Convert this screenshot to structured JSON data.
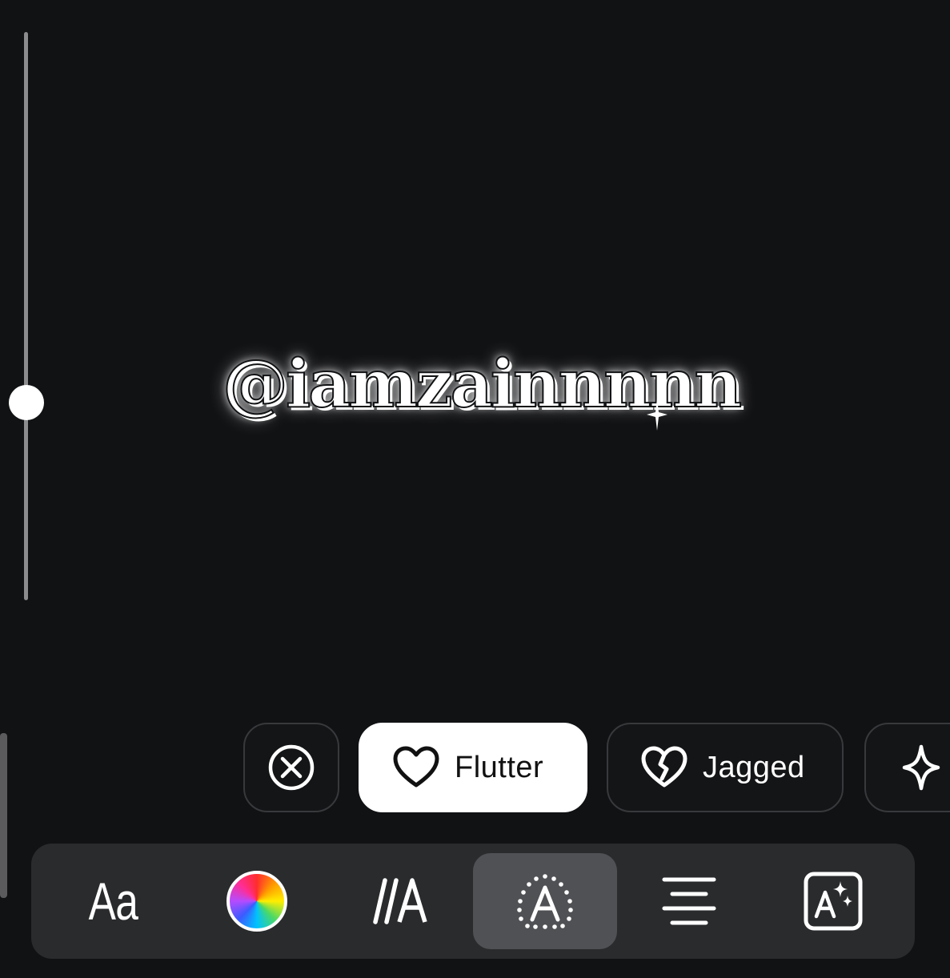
{
  "canvas": {
    "text": "@iamzainnnnn"
  },
  "size_slider": {
    "level": 0.65
  },
  "effects": {
    "items": [
      {
        "id": "none",
        "label": "",
        "icon": "close-circle-icon",
        "selected": false
      },
      {
        "id": "flutter",
        "label": "Flutter",
        "icon": "heart-icon",
        "selected": true
      },
      {
        "id": "jagged",
        "label": "Jagged",
        "icon": "broken-heart-icon",
        "selected": false
      },
      {
        "id": "sparkle",
        "label": "",
        "icon": "sparkle-icon",
        "selected": false
      }
    ]
  },
  "toolbar": {
    "font_label": "Aa",
    "items": [
      {
        "id": "font",
        "icon": "font-icon",
        "active": false
      },
      {
        "id": "color",
        "icon": "color-wheel-icon",
        "active": false
      },
      {
        "id": "style",
        "icon": "text-style-icon",
        "active": false
      },
      {
        "id": "effects",
        "icon": "text-effect-icon",
        "active": true
      },
      {
        "id": "align",
        "icon": "align-center-icon",
        "active": false
      },
      {
        "id": "animate",
        "icon": "ai-text-icon",
        "active": false
      }
    ]
  },
  "colors": {
    "background": "#111214",
    "toolbar_bg": "#2a2b2d",
    "active_tool_bg": "#505154",
    "chip_border": "#38393c",
    "selected_chip_bg": "#ffffff"
  }
}
